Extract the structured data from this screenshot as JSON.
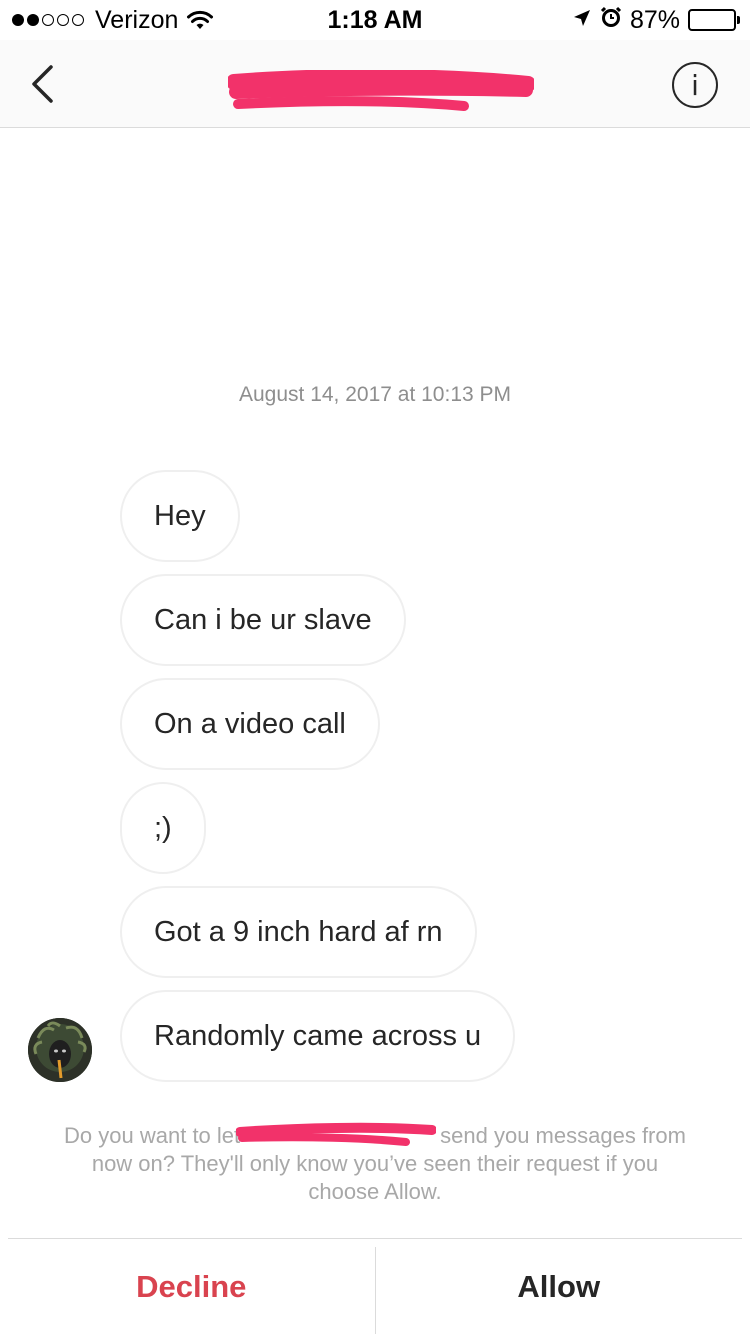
{
  "status_bar": {
    "carrier": "Verizon",
    "time": "1:18 AM",
    "battery_percent": "87%",
    "battery_level": 0.87,
    "signal_bars_filled": 2,
    "signal_bars_total": 5,
    "icons": [
      "wifi-icon",
      "location-arrow-icon",
      "alarm-icon",
      "battery-icon"
    ]
  },
  "header": {
    "back_icon": "chevron-left-icon",
    "title": "",
    "info_label": "i",
    "title_redacted": true
  },
  "thread": {
    "timestamp": "August 14, 2017 at 10:13 PM",
    "messages": [
      {
        "text": "Hey"
      },
      {
        "text": "Can i be ur slave"
      },
      {
        "text": "On a video call"
      },
      {
        "text": ";)"
      },
      {
        "text": "Got a 9 inch hard af rn"
      },
      {
        "text": "Randomly came across u"
      }
    ]
  },
  "request": {
    "line1_before": "Do you want to let",
    "line1_after": "send you messages from",
    "line2": "now on? They'll only know you’ve seen their request if you",
    "line3": "choose Allow."
  },
  "actions": {
    "decline_label": "Decline",
    "allow_label": "Allow"
  },
  "colors": {
    "redaction": "#f2326a",
    "decline": "#d9434f",
    "bubble_border": "#efefef",
    "muted_text": "#a8a8a8"
  }
}
